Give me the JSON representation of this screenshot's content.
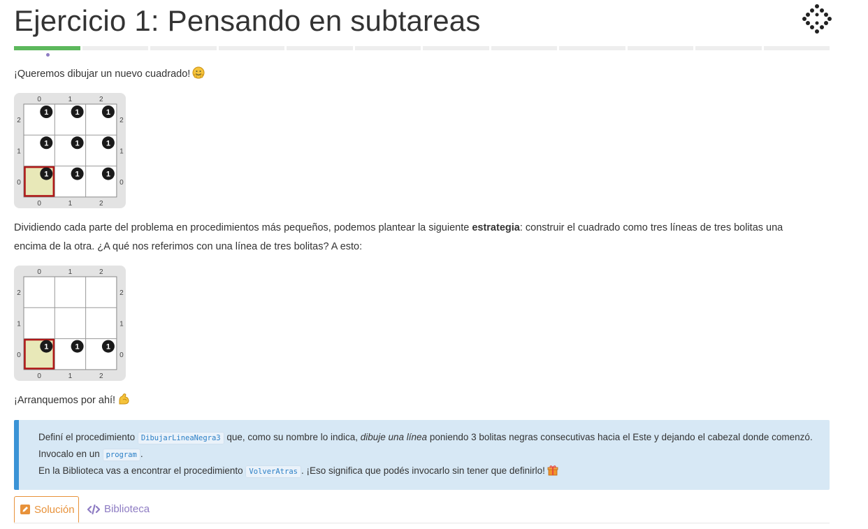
{
  "header": {
    "title": "Ejercicio 1: Pensando en subtareas",
    "logo_icon": "gobstones-diamond-logo"
  },
  "progress": {
    "total_steps": 12,
    "current_step": 1,
    "active_color": "#5cb85c",
    "inactive_color": "#eeeeee"
  },
  "intro": {
    "text": "¡Queremos dibujar un nuevo cuadrado!",
    "emoji": "hugging-face-icon"
  },
  "board1": {
    "col_labels": [
      "0",
      "1",
      "2"
    ],
    "row_labels": [
      "2",
      "1",
      "0"
    ],
    "stone_label": "1",
    "stones": [
      [
        0,
        0
      ],
      [
        1,
        0
      ],
      [
        2,
        0
      ],
      [
        0,
        1
      ],
      [
        1,
        1
      ],
      [
        2,
        1
      ],
      [
        0,
        2
      ],
      [
        1,
        2
      ],
      [
        2,
        2
      ]
    ],
    "head": [
      0,
      0
    ]
  },
  "strategy": {
    "part1": "Dividiendo cada parte del problema en procedimientos más pequeños, podemos plantear la siguiente ",
    "bold": "estrategia",
    "part2": ": construir el cuadrado como tres líneas de tres bolitas una",
    "line2": "encima de la otra. ¿A qué nos referimos con una línea de tres bolitas? A esto:"
  },
  "board2": {
    "col_labels": [
      "0",
      "1",
      "2"
    ],
    "row_labels": [
      "2",
      "1",
      "0"
    ],
    "stone_label": "1",
    "stones": [
      [
        0,
        0
      ],
      [
        1,
        0
      ],
      [
        2,
        0
      ]
    ],
    "head": [
      0,
      0
    ]
  },
  "start": {
    "text": "¡Arranquemos por ahí!",
    "emoji": "flexed-biceps-icon"
  },
  "callout": {
    "l1a": "Definí el procedimiento ",
    "code1": "DibujarLineaNegra3",
    "l1b": " que, como su nombre lo indica, ",
    "l1em": "dibuje una línea",
    "l1c": " poniendo 3 bolitas negras consecutivas hacia el Este y dejando el cabezal donde comenzó.",
    "l2a": "Invocalo en un ",
    "code2": "program",
    "l2b": ".",
    "l3a": "En la Biblioteca vas a encontrar el procedimiento ",
    "code3": "VolverAtras",
    "l3b": ". ¡Eso significa que podés invocarlo sin tener que definirlo!",
    "l3emoji": "gift-icon",
    "accent_color": "#3a93d6",
    "background_color": "#d7e8f5"
  },
  "tabs": [
    {
      "label": "Solución",
      "icon": "edit-icon",
      "active": true
    },
    {
      "label": "Biblioteca",
      "icon": "code-icon",
      "active": false
    }
  ]
}
